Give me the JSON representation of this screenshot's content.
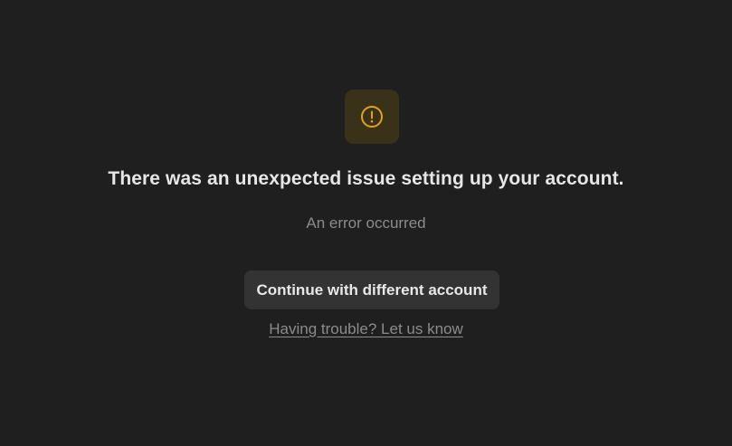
{
  "error_icon": {
    "icon": "exclamation-circle-icon",
    "color": "#e2a317",
    "background": "#3a3119"
  },
  "headline": "There was an unexpected issue setting up your account.",
  "subtext": "An error occurred",
  "primary_button": {
    "label": "Continue with different account"
  },
  "help_link": {
    "label": "Having trouble? Let us know"
  }
}
